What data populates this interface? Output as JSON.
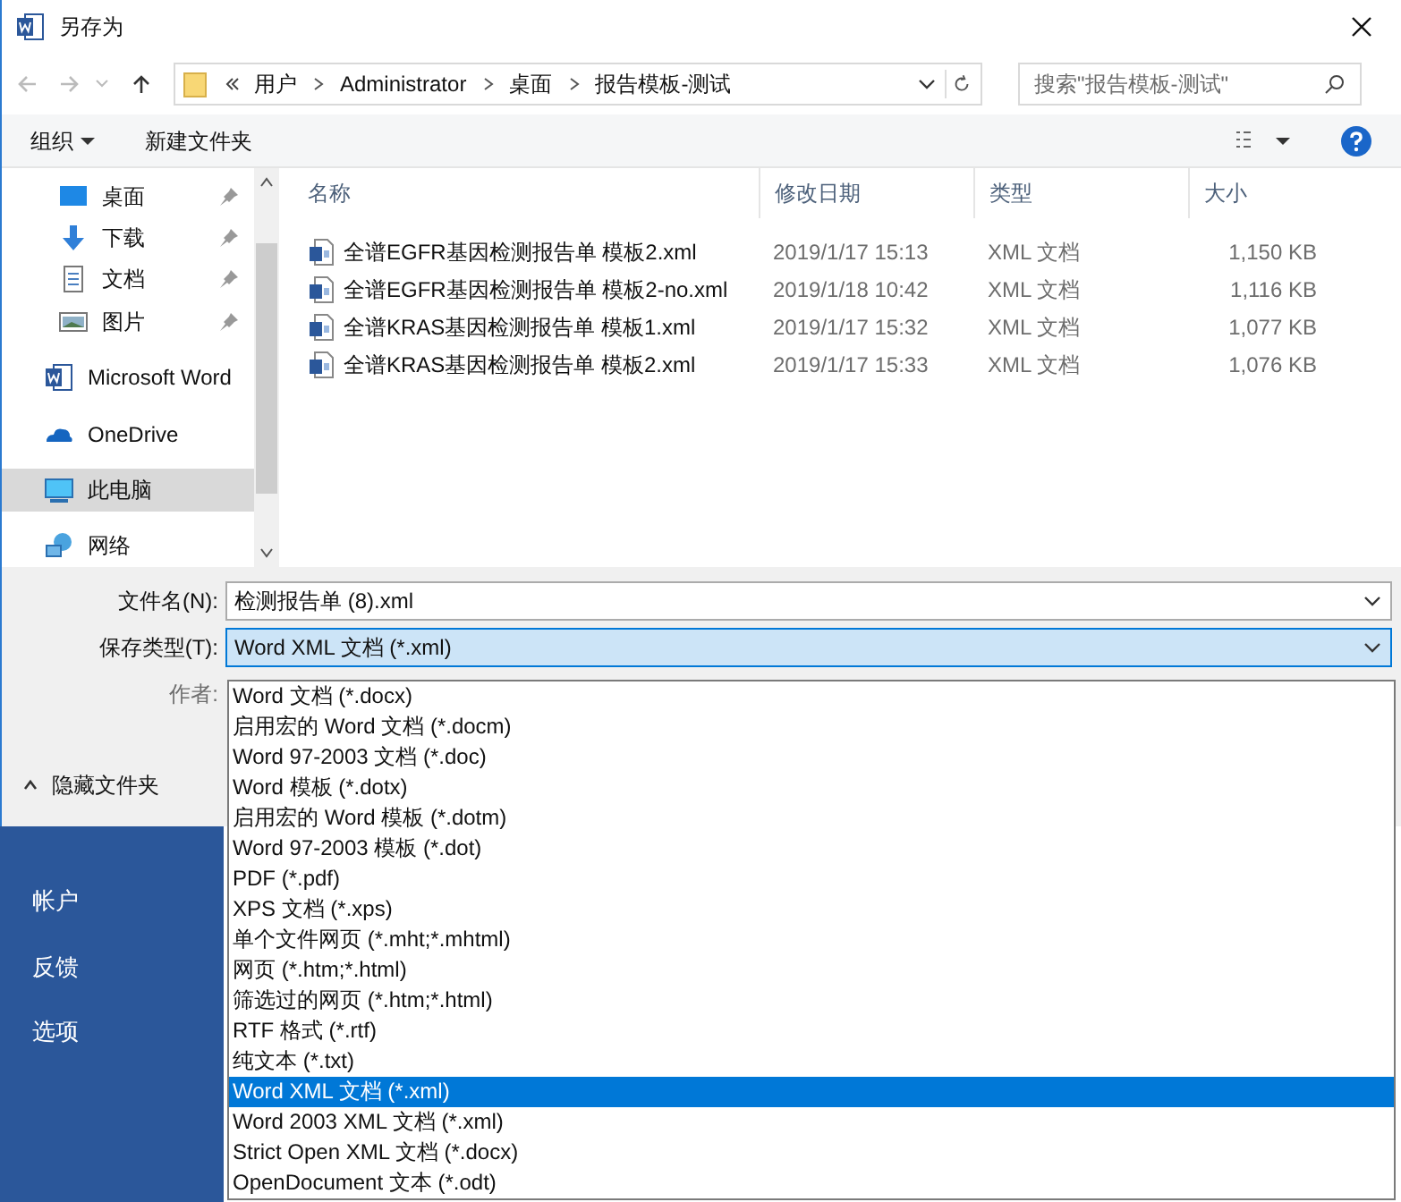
{
  "window": {
    "title": "另存为"
  },
  "address": {
    "crumbs": [
      "用户",
      "Administrator",
      "桌面",
      "报告模板-测试"
    ]
  },
  "search": {
    "placeholder": "搜索\"报告模板-测试\""
  },
  "toolbar": {
    "organize": "组织",
    "new_folder": "新建文件夹"
  },
  "nav": {
    "items": [
      {
        "label": "桌面",
        "kind": "desktop",
        "pinned": true,
        "selected": false
      },
      {
        "label": "下载",
        "kind": "download",
        "pinned": true,
        "selected": false
      },
      {
        "label": "文档",
        "kind": "document",
        "pinned": true,
        "selected": false
      },
      {
        "label": "图片",
        "kind": "picture",
        "pinned": true,
        "selected": false
      },
      {
        "label": "Microsoft Word",
        "kind": "word",
        "pinned": false,
        "selected": false
      },
      {
        "label": "OneDrive",
        "kind": "cloud",
        "pinned": false,
        "selected": false
      },
      {
        "label": "此电脑",
        "kind": "computer",
        "pinned": false,
        "selected": true
      },
      {
        "label": "网络",
        "kind": "network",
        "pinned": false,
        "selected": false
      }
    ]
  },
  "table": {
    "columns": [
      "名称",
      "修改日期",
      "类型",
      "大小"
    ],
    "rows": [
      {
        "name": "全谱EGFR基因检测报告单 模板2.xml",
        "date": "2019/1/17 15:13",
        "type": "XML 文档",
        "size": "1,150 KB"
      },
      {
        "name": "全谱EGFR基因检测报告单 模板2-no.xml",
        "date": "2019/1/18 10:42",
        "type": "XML 文档",
        "size": "1,116 KB"
      },
      {
        "name": "全谱KRAS基因检测报告单 模板1.xml",
        "date": "2019/1/17 15:32",
        "type": "XML 文档",
        "size": "1,077 KB"
      },
      {
        "name": "全谱KRAS基因检测报告单 模板2.xml",
        "date": "2019/1/17 15:33",
        "type": "XML 文档",
        "size": "1,076 KB"
      }
    ]
  },
  "form": {
    "filename_label": "文件名(N):",
    "filename": "检测报告单 (8).xml",
    "type_label": "保存类型(T):",
    "type_value": "Word XML 文档 (*.xml)",
    "author_label": "作者:",
    "hide_folders": "隐藏文件夹"
  },
  "type_options": [
    {
      "label": "Word 文档 (*.docx)",
      "selected": false
    },
    {
      "label": "启用宏的 Word 文档 (*.docm)",
      "selected": false
    },
    {
      "label": "Word 97-2003 文档 (*.doc)",
      "selected": false
    },
    {
      "label": "Word 模板 (*.dotx)",
      "selected": false
    },
    {
      "label": "启用宏的 Word 模板 (*.dotm)",
      "selected": false
    },
    {
      "label": "Word 97-2003 模板 (*.dot)",
      "selected": false
    },
    {
      "label": "PDF (*.pdf)",
      "selected": false
    },
    {
      "label": "XPS 文档 (*.xps)",
      "selected": false
    },
    {
      "label": "单个文件网页 (*.mht;*.mhtml)",
      "selected": false
    },
    {
      "label": "网页 (*.htm;*.html)",
      "selected": false
    },
    {
      "label": "筛选过的网页 (*.htm;*.html)",
      "selected": false
    },
    {
      "label": "RTF 格式 (*.rtf)",
      "selected": false
    },
    {
      "label": "纯文本 (*.txt)",
      "selected": false
    },
    {
      "label": "Word XML 文档 (*.xml)",
      "selected": true
    },
    {
      "label": "Word 2003 XML 文档 (*.xml)",
      "selected": false
    },
    {
      "label": "Strict Open XML 文档 (*.docx)",
      "selected": false
    },
    {
      "label": "OpenDocument 文本 (*.odt)",
      "selected": false
    }
  ],
  "backstage": {
    "items": [
      "帐户",
      "反馈",
      "选项"
    ]
  }
}
